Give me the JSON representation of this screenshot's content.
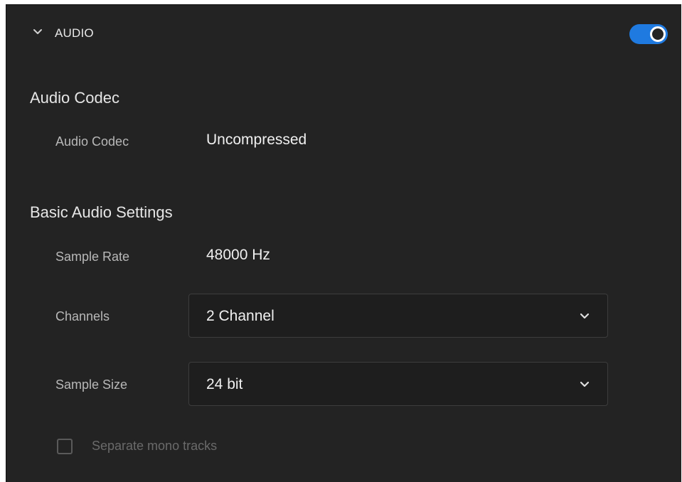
{
  "section": {
    "title": "AUDIO",
    "enabled": true,
    "accent_color": "#1f7ae0"
  },
  "codec_group": {
    "title": "Audio Codec",
    "codec_label": "Audio Codec",
    "codec_value": "Uncompressed"
  },
  "basic_group": {
    "title": "Basic Audio Settings",
    "sample_rate_label": "Sample Rate",
    "sample_rate_value": "48000 Hz",
    "channels_label": "Channels",
    "channels_value": "2 Channel",
    "sample_size_label": "Sample Size",
    "sample_size_value": "24 bit"
  },
  "mono_tracks": {
    "label": "Separate mono tracks",
    "checked": false,
    "disabled": true
  },
  "icons": {
    "section_toggle": "chevron-down-icon",
    "dropdown": "chevron-down-icon",
    "enable_switch": "toggle-switch"
  }
}
